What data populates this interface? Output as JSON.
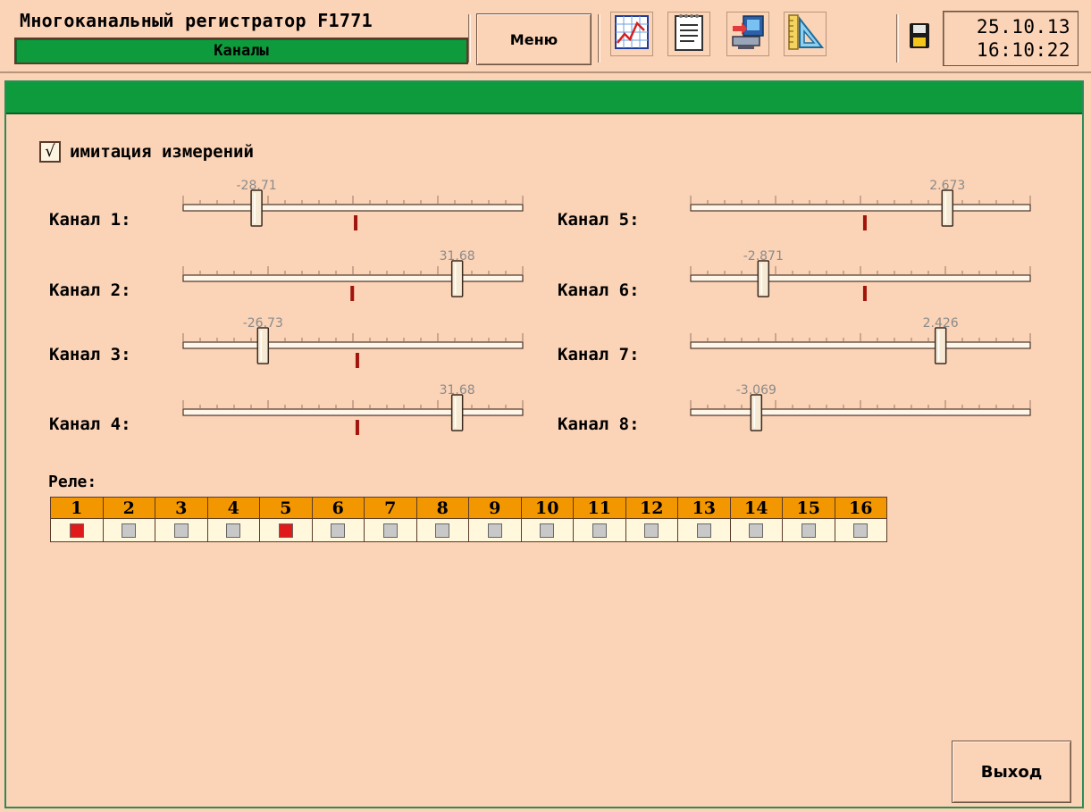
{
  "header": {
    "title": "Многоканальный регистратор F1771",
    "subtitle": "Каналы",
    "menu_label": "Меню",
    "tools": [
      {
        "icon": "trend-chart-icon"
      },
      {
        "icon": "notepad-icon"
      },
      {
        "icon": "computer-transfer-icon"
      },
      {
        "icon": "ruler-triangle-icon"
      }
    ],
    "save_icon": "floppy-disk-icon",
    "date": "25.10.13",
    "time": "16:10:22"
  },
  "simulation": {
    "checked": true,
    "mark": "√",
    "label": "имитация измерений"
  },
  "channels": [
    {
      "label": "Канал 1:",
      "value": "-28.71",
      "fraction": 0.216,
      "marker": 0.508
    },
    {
      "label": "Канал 2:",
      "value": "31.68",
      "fraction": 0.807,
      "marker": 0.498
    },
    {
      "label": "Канал 3:",
      "value": "-26.73",
      "fraction": 0.235,
      "marker": 0.513
    },
    {
      "label": "Канал 4:",
      "value": "31.68",
      "fraction": 0.807,
      "marker": 0.513
    },
    {
      "label": "Канал 5:",
      "value": "2.673",
      "fraction": 0.756,
      "marker": 0.513
    },
    {
      "label": "Канал 6:",
      "value": "-2.871",
      "fraction": 0.214,
      "marker": 0.513
    },
    {
      "label": "Канал 7:",
      "value": "2.426",
      "fraction": 0.736,
      "marker": null
    },
    {
      "label": "Канал 8:",
      "value": "-3.069",
      "fraction": 0.193,
      "marker": null
    }
  ],
  "relay": {
    "title": "Реле:",
    "items": [
      {
        "num": "1",
        "on": true
      },
      {
        "num": "2",
        "on": false
      },
      {
        "num": "3",
        "on": false
      },
      {
        "num": "4",
        "on": false
      },
      {
        "num": "5",
        "on": true
      },
      {
        "num": "6",
        "on": false
      },
      {
        "num": "7",
        "on": false
      },
      {
        "num": "8",
        "on": false
      },
      {
        "num": "9",
        "on": false
      },
      {
        "num": "10",
        "on": false
      },
      {
        "num": "11",
        "on": false
      },
      {
        "num": "12",
        "on": false
      },
      {
        "num": "13",
        "on": false
      },
      {
        "num": "14",
        "on": false
      },
      {
        "num": "15",
        "on": false
      },
      {
        "num": "16",
        "on": false
      }
    ],
    "on_color": "#e01a1a",
    "off_color": "#c8c8c8"
  },
  "exit_label": "Выход",
  "colors": {
    "background": "#fbd3b6",
    "accent_green": "#0d9b3d",
    "relay_header": "#f39700",
    "marker": "#a0140c"
  }
}
